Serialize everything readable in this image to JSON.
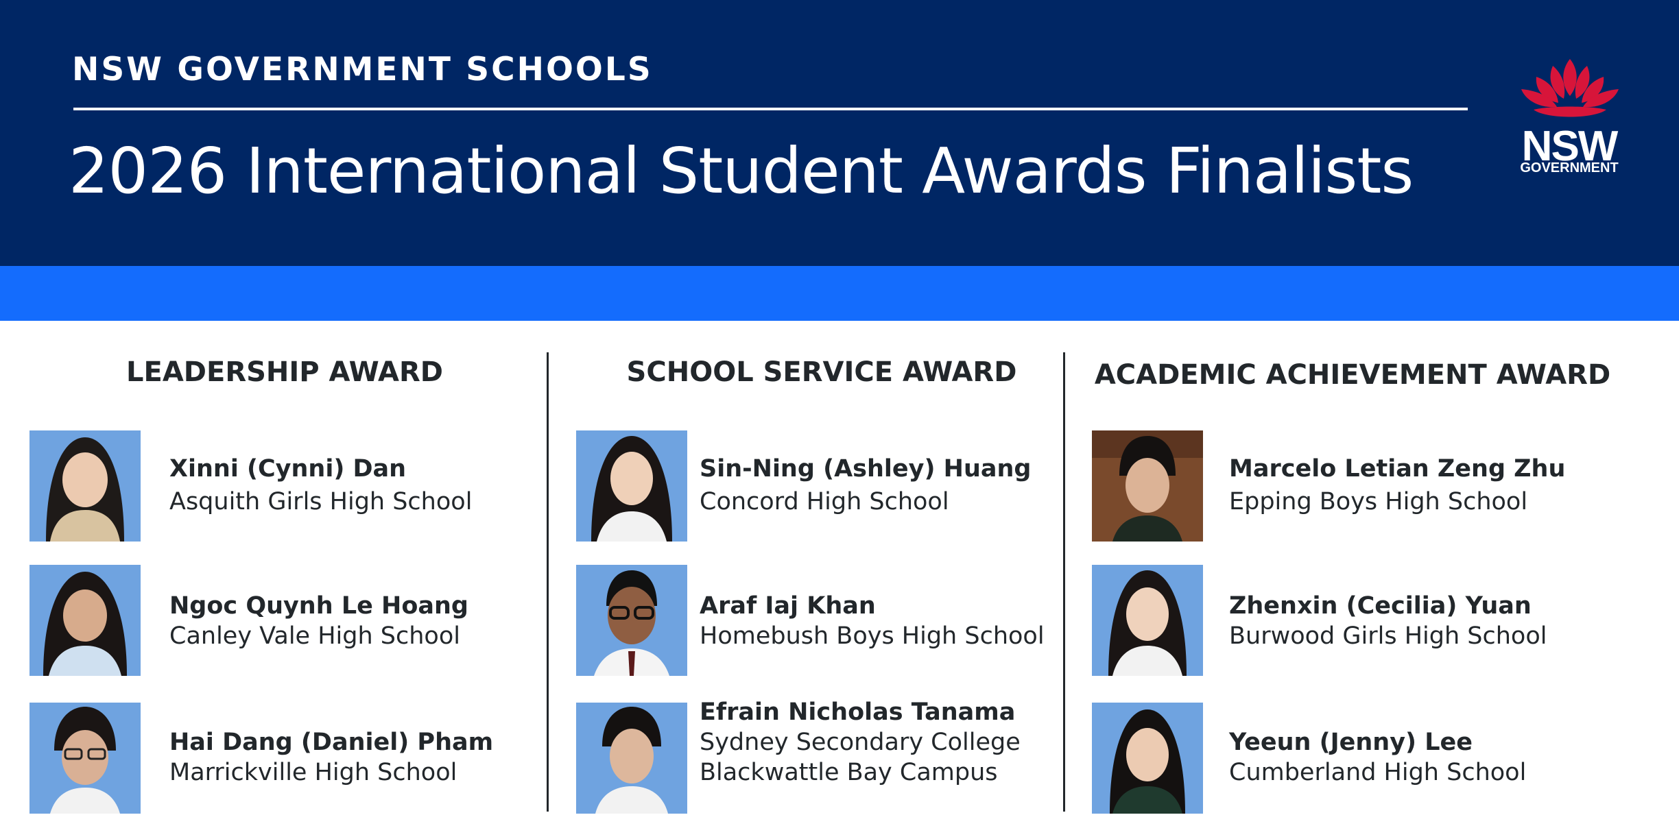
{
  "header": {
    "kicker": "NSW GOVERNMENT SCHOOLS",
    "title": "2026 International Student Awards Finalists",
    "logo_word": "NSW",
    "logo_sub": "GOVERNMENT"
  },
  "colors": {
    "navy": "#002664",
    "blue_band": "#146cfd",
    "waratah_red": "#d7153a",
    "text": "#22272b"
  },
  "awards": [
    {
      "title": "LEADERSHIP AWARD",
      "finalists": [
        {
          "name": "Xinni (Cynni) Dan",
          "school": "Asquith Girls High School"
        },
        {
          "name": "Ngoc Quynh Le Hoang",
          "school": "Canley Vale High School"
        },
        {
          "name": "Hai Dang (Daniel) Pham",
          "school": "Marrickville High School"
        }
      ]
    },
    {
      "title": "SCHOOL SERVICE AWARD",
      "finalists": [
        {
          "name": "Sin-Ning (Ashley) Huang",
          "school": "Concord High School"
        },
        {
          "name": "Araf Iaj Khan",
          "school": "Homebush Boys High School"
        },
        {
          "name": "Efrain Nicholas Tanama",
          "school": "Sydney Secondary College",
          "school_line2": "Blackwattle Bay Campus"
        }
      ]
    },
    {
      "title": "ACADEMIC ACHIEVEMENT AWARD",
      "finalists": [
        {
          "name": "Marcelo Letian Zeng Zhu",
          "school": "Epping Boys High School"
        },
        {
          "name": "Zhenxin (Cecilia) Yuan",
          "school": "Burwood Girls High School"
        },
        {
          "name": "Yeeun (Jenny) Lee",
          "school": "Cumberland High School"
        }
      ]
    }
  ]
}
